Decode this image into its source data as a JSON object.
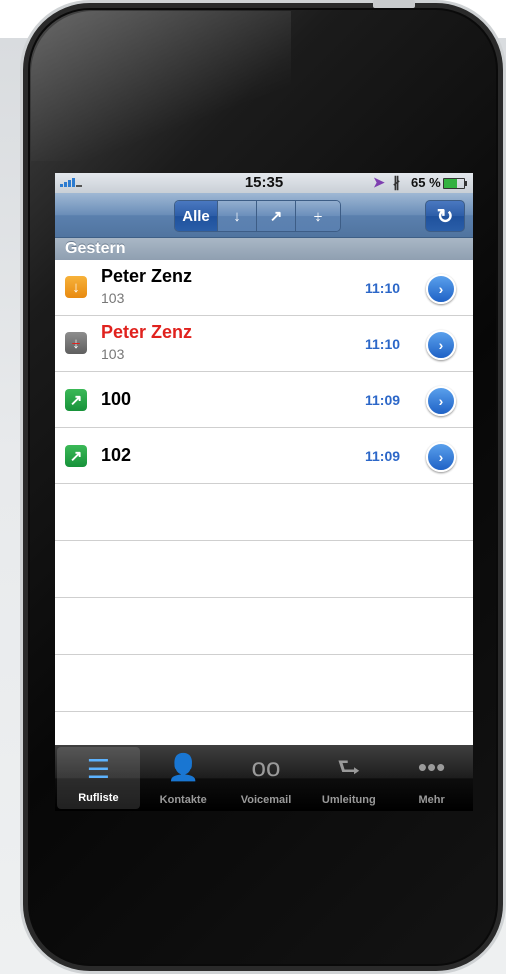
{
  "status_bar": {
    "time": "15:35",
    "battery": "65 %"
  },
  "filter": {
    "all_label": "Alle",
    "incoming_icon": "arrow-down-icon",
    "outgoing_icon": "arrow-up-right-icon",
    "missed_icon": "missed-call-icon"
  },
  "refresh_icon": "refresh-icon",
  "section_header": "Gestern",
  "calls": [
    {
      "name": "Peter Zenz",
      "number": "103",
      "time": "11:10",
      "type": "incoming",
      "missed": false
    },
    {
      "name": "Peter Zenz",
      "number": "103",
      "time": "11:10",
      "type": "missed",
      "missed": true
    },
    {
      "name": "100",
      "number": "",
      "time": "11:09",
      "type": "outgoing",
      "missed": false
    },
    {
      "name": "102",
      "number": "",
      "time": "11:09",
      "type": "outgoing",
      "missed": false
    }
  ],
  "tabs": [
    {
      "label": "Rufliste",
      "icon": "list-icon",
      "selected": true
    },
    {
      "label": "Kontakte",
      "icon": "person-icon",
      "selected": false
    },
    {
      "label": "Voicemail",
      "icon": "voicemail-icon",
      "selected": false
    },
    {
      "label": "Umleitung",
      "icon": "forward-icon",
      "selected": false
    },
    {
      "label": "Mehr",
      "icon": "more-icon",
      "selected": false
    }
  ],
  "colors": {
    "accent": "#2c67c8",
    "missed": "#e0221e",
    "incoming": "#f0a020",
    "outgoing": "#2aa84a"
  }
}
